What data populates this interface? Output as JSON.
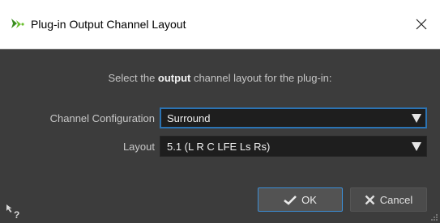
{
  "window": {
    "title": "Plug-in Output Channel Layout",
    "icon": "plugin-arrow-icon"
  },
  "prompt": {
    "before": "Select the ",
    "bold": "output",
    "after": " channel layout for the plug-in:"
  },
  "fields": {
    "channel_configuration": {
      "label": "Channel Configuration",
      "value": "Surround"
    },
    "layout": {
      "label": "Layout",
      "value": "5.1 (L R C LFE Ls Rs)"
    }
  },
  "buttons": {
    "ok": "OK",
    "cancel": "Cancel"
  },
  "colors": {
    "accent": "#2b73b3",
    "background": "#3c3c3c",
    "field_bg": "#1e1e1e"
  }
}
